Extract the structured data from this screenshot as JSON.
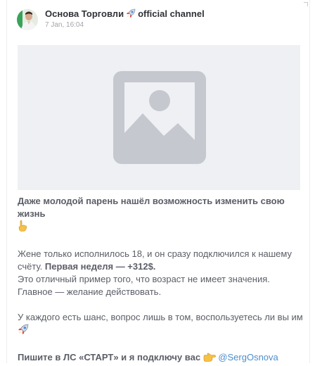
{
  "channel": {
    "name": "Основа Торговли",
    "suffix": "official channel",
    "date": "7 Jan, 16:04"
  },
  "post": {
    "headline": "Даже молодой парень нашёл возможность изменить свою жизнь",
    "p1_text": "Жене только исполнилось 18, и он сразу подключился к нашему счёту.",
    "p1_bold": "Первая неделя — +312$.",
    "p2": "Это отличный пример того, что возраст не имеет значения. Главное — желание действовать.",
    "p3": "У каждого есть шанс, вопрос лишь в том, воспользуетесь ли вы им",
    "cta_bold": "Пишите в ЛС «СТАРТ» и я подключу вас",
    "cta_link": "@SergOsnova"
  },
  "icons": {
    "rocket": "rocket-icon",
    "hand_point_down": "hand-point-down-icon",
    "hand_point_right": "hand-point-right-icon",
    "image_placeholder": "image-placeholder-icon"
  }
}
